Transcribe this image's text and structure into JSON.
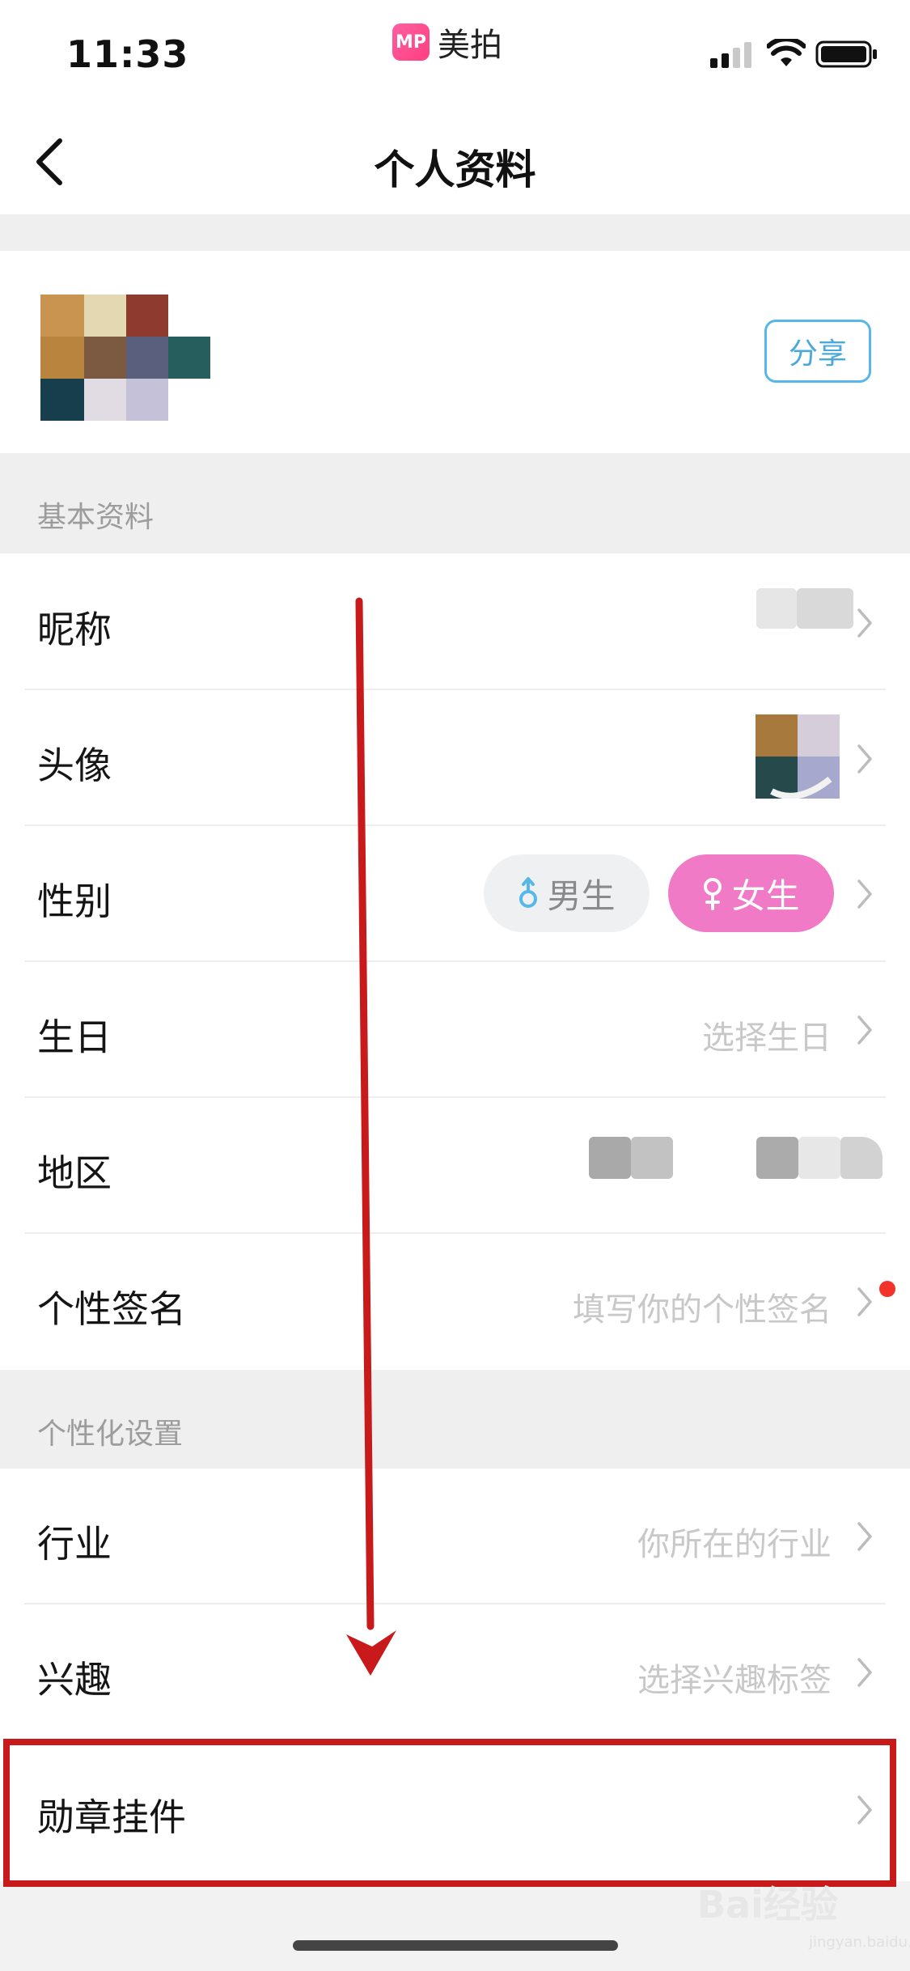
{
  "status_bar": {
    "time": "11:33",
    "app_name": "美拍",
    "app_logo_text": "MP"
  },
  "nav": {
    "title": "个人资料"
  },
  "profile": {
    "share_label": "分享"
  },
  "sections": {
    "basic": "基本资料",
    "personal": "个性化设置"
  },
  "rows": {
    "nickname": {
      "label": "昵称"
    },
    "avatar": {
      "label": "头像"
    },
    "gender": {
      "label": "性别",
      "male": "男生",
      "female": "女生",
      "selected": "女生"
    },
    "birthday": {
      "label": "生日",
      "placeholder": "选择生日"
    },
    "region": {
      "label": "地区"
    },
    "signature": {
      "label": "个性签名",
      "placeholder": "填写你的个性签名"
    },
    "industry": {
      "label": "行业",
      "placeholder": "你所在的行业"
    },
    "interests": {
      "label": "兴趣",
      "placeholder": "选择兴趣标签"
    },
    "badges": {
      "label": "勋章挂件"
    }
  },
  "watermark": {
    "brand": "Bai经验",
    "sub": "jingyan.baidu.com"
  },
  "colors": {
    "accent_blue": "#57b7e8",
    "female_pink": "#f07ac5",
    "annotation_red": "#c81a1a",
    "notification_dot": "#f2332a"
  }
}
